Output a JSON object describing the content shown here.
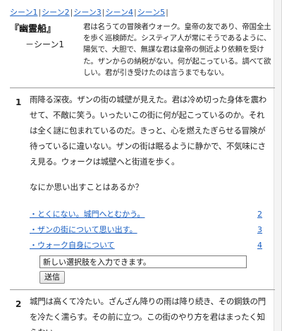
{
  "scene_nav": {
    "items": [
      "シーン1",
      "シーン2",
      "シーン3",
      "シーン4",
      "シーン5"
    ],
    "separator": "|"
  },
  "header": {
    "story_title": "『幽霊船』",
    "scene_label": "－シーン1",
    "intro": "君は名うての冒険者ウォーク。皇帝の友であり、帝国全土を歩く巡検師だ。システィア人が常にそうであるように、陽気で、大胆で、無謀な君は皇帝の側近より依頼を受けた。ザンからの納税がない。何が起こっている。調べて欲しい。君が引き受けたのは言うまでもない。"
  },
  "blocks": [
    {
      "number": "1",
      "narration": "雨降る深夜。ザンの街の城壁が見えた。君は冷め切った身体を震わせて、不敵に笑う。いったいこの街に何が起こっているのか。それは全く謎に包まれているのだ。きっと、心を燃えたぎらせる冒険が待っているに違いない。ザンの街は眠るように静かで、不気味にさえ見る。ウォークは城壁へと街道を歩く。",
      "prompt": "なにか思い出すことはあるか？",
      "choices": [
        {
          "text": "・とくにない。城門へとむかう。",
          "target": "2"
        },
        {
          "text": "・ザンの街について思い出す。",
          "target": "3"
        },
        {
          "text": "・ウォーク自身について",
          "target": "4"
        }
      ],
      "new_choice_input": {
        "value": "新しい選択肢を入力できます。"
      },
      "submit_label": "送信"
    },
    {
      "number": "2",
      "narration": "城門は高くて冷たい。ざんざん降りの雨は降り続き、その鋼鉄の門を冷たく濡らす。その前に立つ。この街のやり方を君はまったく知らない"
    }
  ]
}
